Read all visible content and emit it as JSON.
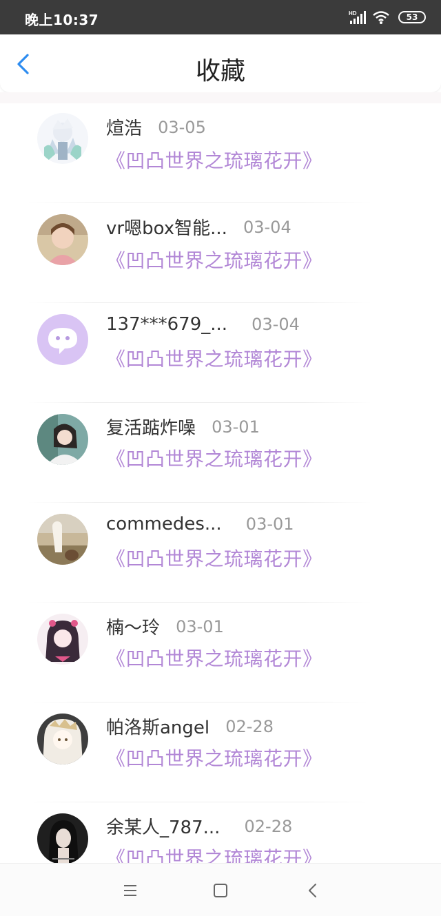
{
  "status_bar": {
    "time": "晚上10:37",
    "signal_label": "HD",
    "battery_level": "53",
    "icons": [
      "signal-icon",
      "wifi-icon",
      "battery-icon"
    ]
  },
  "header": {
    "title": "收藏",
    "back_icon": "chevron-left-icon",
    "accent_color": "#2d8cf0"
  },
  "list": {
    "items": [
      {
        "username": "煊浩",
        "date": "03-05",
        "work": "《凹凸世界之琉璃花开》"
      },
      {
        "username": "vr嗯box智能...",
        "date": "03-04",
        "work": "《凹凸世界之琉璃花开》"
      },
      {
        "username": "137***679_...",
        "date": "03-04",
        "work": "《凹凸世界之琉璃花开》"
      },
      {
        "username": "复活踮炸噪",
        "date": "03-01",
        "work": "《凹凸世界之琉璃花开》"
      },
      {
        "username": "commedes...",
        "date": "03-01",
        "work": "《凹凸世界之琉璃花开》"
      },
      {
        "username": "楠～玲",
        "date": "03-01",
        "work": "《凹凸世界之琉璃花开》"
      },
      {
        "username": "帕洛斯angel",
        "date": "02-28",
        "work": "《凹凸世界之琉璃花开》"
      },
      {
        "username": "余某人_787...",
        "date": "02-28",
        "work": "《凹凸世界之琉璃花开》"
      }
    ],
    "title_color": "#b287d6"
  },
  "nav_bar": {
    "icons": [
      "menu-icon",
      "home-square-icon",
      "back-chevron-icon"
    ]
  }
}
